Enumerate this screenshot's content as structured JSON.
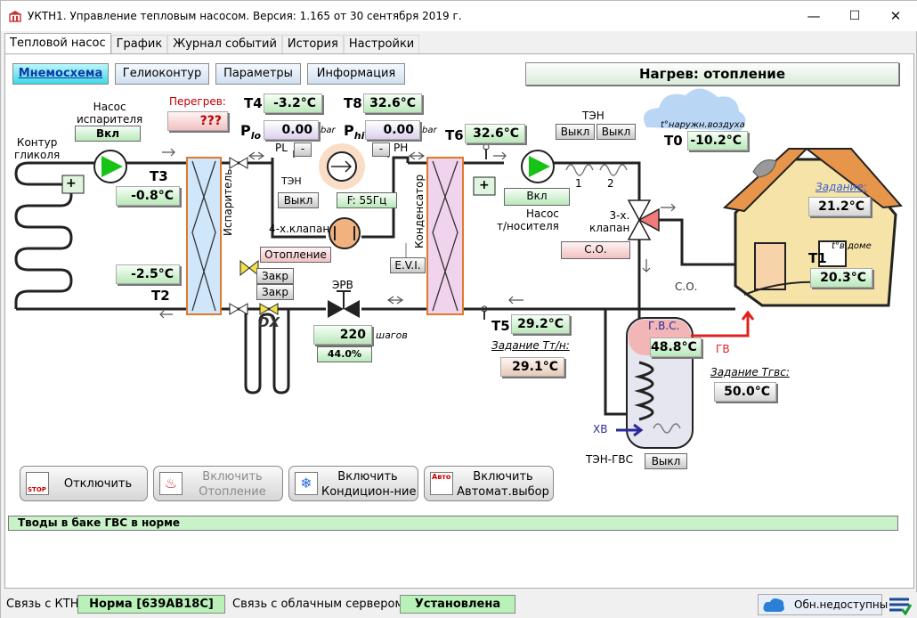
{
  "window": {
    "title": "УКТН1. Управление тепловым насосом. Версия: 1.165 от 30 сентября 2019 г.",
    "min": "—",
    "max": "☐",
    "close": "✕"
  },
  "tabs": [
    "Тепловой насос",
    "График",
    "Журнал событий",
    "История",
    "Настройки"
  ],
  "subtabs": [
    "Мнемосхема",
    "Гелиоконтур",
    "Параметры",
    "Информация"
  ],
  "mode": "Нагрев: отопление",
  "labels": {
    "glycol": "Контур\nгликоля",
    "evap_pump": "Насос\nиспарителя",
    "overheat": "Перегрев:",
    "evaporator": "Испаритель",
    "condenser": "Конденсатор",
    "ten_small": "ТЭН",
    "valve4": "4-х.клапан",
    "pl": "PL",
    "ph": "PH",
    "plo": "P",
    "plo_sub": "lo",
    "phi": "P",
    "phi_sub": "hi",
    "bar": "bar",
    "erv": "ЭРВ",
    "dx": "DX",
    "steps": "шагов",
    "pump_carrier": "Насос\nт/носителя",
    "valve3": "3-х.\nклапан",
    "ten_top": "ТЭН",
    "ten1": "1",
    "ten2": "2",
    "outdoor": "t°наружн.воздуха",
    "setpoint": "Задание:",
    "indoor": "t°в доме",
    "co": "С.О.",
    "gvs": "Г.В.С.",
    "gv": "ГВ",
    "hv": "ХВ",
    "set_gvs": "Задание Tгвс:",
    "set_tn": "Задание Tт/н:",
    "ten_gvs": "ТЭН-ГВС"
  },
  "sensors": {
    "T4": {
      "name": "T4",
      "value": "-3.2°C"
    },
    "T8": {
      "name": "T8",
      "value": "32.6°C"
    },
    "T3": {
      "name": "T3",
      "value": "-0.8°C"
    },
    "T2": {
      "name": "T2",
      "value": "-2.5°C"
    },
    "T6": {
      "name": "T6",
      "value": "32.6°C"
    },
    "T0": {
      "name": "T0",
      "value": "-10.2°C"
    },
    "T1": {
      "name": "T1",
      "value": "20.3°C"
    },
    "T5": {
      "name": "T5",
      "value": "29.2°C"
    }
  },
  "values": {
    "overheat": "???",
    "plo": "0.00",
    "phi": "0.00",
    "room_set": "21.2°C",
    "erv_steps": "220",
    "erv_pct": "44.0%",
    "tn_set": "29.1°C",
    "gvs_temp": "48.8°C",
    "gvs_set": "50.0°C",
    "freq": "F: 55Гц"
  },
  "states": {
    "evap_pump": "Вкл",
    "carrier_pump": "Вкл",
    "ten_small": "Выкл",
    "ten1": "Выкл",
    "ten2": "Выкл",
    "heating": "Отопление",
    "zakr1": "Закр",
    "zakr2": "Закр",
    "evi": "E.V.I.",
    "co_btn": "С.О.",
    "ten_gvs": "Выкл",
    "pl_box": "-",
    "ph_box": "-",
    "plus": "+"
  },
  "actions": [
    {
      "icon": "STOP",
      "label": "Отключить",
      "disabled": false
    },
    {
      "icon": "",
      "label": "Включить\nОтопление",
      "disabled": true
    },
    {
      "icon": "",
      "label": "Включить\nКондицион-ние",
      "disabled": false
    },
    {
      "icon": "Авто",
      "label": "Включить\nАвтомат.выбор",
      "disabled": false
    }
  ],
  "status_message": "Тводы в баке ГВС в норме",
  "bottom": {
    "ktn_label": "Связь с КТН:",
    "ktn_value": "Норма [639AB18C]",
    "cloud_label": "Связь с облачным сервером:",
    "cloud_value": "Установлена",
    "updates": "Обн.недоступны"
  },
  "colors": {
    "green_field": "#b9e8b9",
    "pink_field": "#f2c1c1",
    "lavender_field": "#dcd0ee",
    "tan_field": "#e6c9b7",
    "pump_green": "#16c316",
    "heat_red": "#e02020"
  }
}
